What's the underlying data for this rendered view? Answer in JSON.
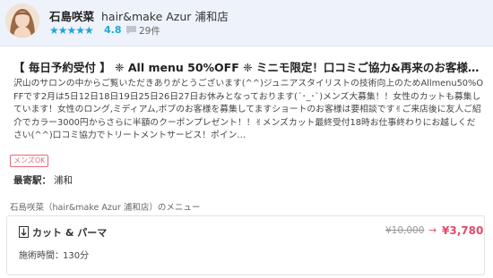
{
  "header": {
    "stylist_name": "石島咲菜",
    "salon_name": "hair&make Azur 浦和店",
    "stars": "★★★★★",
    "rating": "4.8",
    "review_count": "29件"
  },
  "post": {
    "title": "【 毎日予約受付 】 ❈ All menu 50%OFF ❈ ミニモ限定！口コミご協力&再来のお客様…",
    "description": "沢山のサロンの中からご覧いただきありがとうございます(^^)ジュニアスタイリストの技術向上のためAllmenu50%OFFです2月は5日12日18日19日25日26日27日お休みとなっております(´･_･`)メンズ大募集！！女性のカットも募集しています！女性のロング,ミディアム,ボブのお客様を募集してますショートのお客様は要相談です✌ご来店後に友人ご紹介でカラー3000円からさらに半額のクーポンプレゼント！！✌メンズカット最終受付18時お仕事終わりにお越しください(^^)口コミ協力でトリートメントサービス！ポイン…",
    "tag": "メンズOK",
    "station_label": "最寄駅：",
    "station_value": "浦和"
  },
  "menu": {
    "section_title": "石島咲菜（hair&make Azur 浦和店）のメニュー",
    "items": [
      {
        "name": "カット & パーマ",
        "old_price": "¥10,000",
        "arrow": "→",
        "new_price": "¥3,780",
        "duration_label": "施術時間：",
        "duration_value": "130分"
      }
    ]
  },
  "colors": {
    "accent": "#1fa6d6",
    "price": "#e24b6a",
    "tag": "#e2687e",
    "header_bg": "#eef3fb"
  },
  "icons": {
    "avatar": "stylist-avatar",
    "review": "comment-bubble-icon",
    "menu": "menu-tag-icon"
  }
}
